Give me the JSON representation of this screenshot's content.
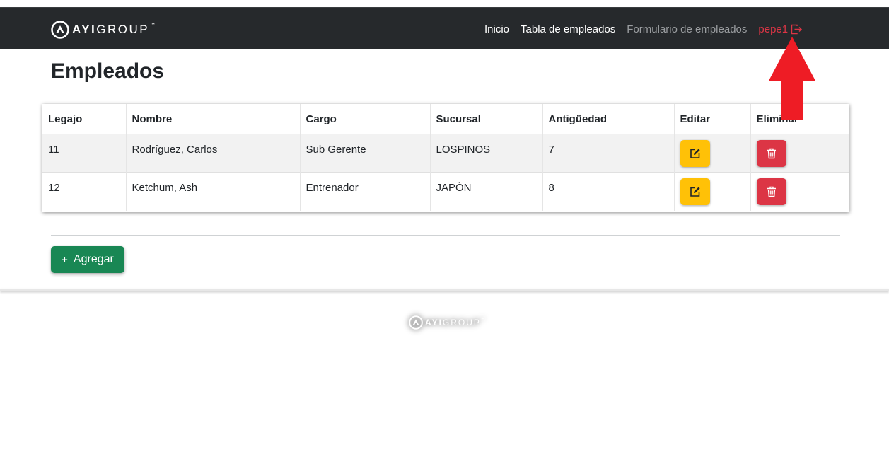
{
  "brand": {
    "bold": "AYI",
    "light": "GROUP",
    "tm": "™"
  },
  "nav": {
    "inicio": "Inicio",
    "tabla": "Tabla de empleados",
    "formulario": "Formulario de empleados",
    "user": "pepe1"
  },
  "page": {
    "title": "Empleados"
  },
  "table": {
    "headers": [
      "Legajo",
      "Nombre",
      "Cargo",
      "Sucursal",
      "Antigüedad",
      "Editar",
      "Eliminar"
    ],
    "rows": [
      {
        "legajo": "11",
        "nombre": "Rodríguez, Carlos",
        "cargo": "Sub Gerente",
        "sucursal": "LOSPINOS",
        "antiguedad": "7"
      },
      {
        "legajo": "12",
        "nombre": "Ketchum, Ash",
        "cargo": "Entrenador",
        "sucursal": "JAPÓN",
        "antiguedad": "8"
      }
    ]
  },
  "actions": {
    "add_label": "Agregar",
    "add_icon": "+"
  },
  "icons": {
    "edit": "pencil-square-icon",
    "delete": "trash-icon",
    "logout": "box-arrow-right-icon"
  },
  "colors": {
    "navbar": "#26292c",
    "edit": "#ffc107",
    "delete": "#dc3545",
    "add": "#198754",
    "user": "#dc3545",
    "arrow": "#ee1c25"
  }
}
